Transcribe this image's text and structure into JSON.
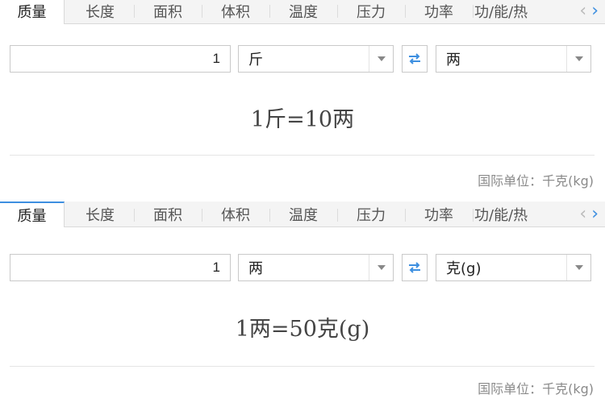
{
  "panels": [
    {
      "tabs": [
        "质量",
        "长度",
        "面积",
        "体积",
        "温度",
        "压力",
        "功率",
        "功/能/热"
      ],
      "active_tab": "质量",
      "input_value": "1",
      "from_unit": "斤",
      "to_unit": "两",
      "result": "1斤=10两",
      "footer": "国际单位：千克(kg)"
    },
    {
      "tabs": [
        "质量",
        "长度",
        "面积",
        "体积",
        "温度",
        "压力",
        "功率",
        "功/能/热"
      ],
      "active_tab": "质量",
      "input_value": "1",
      "from_unit": "两",
      "to_unit": "克(g)",
      "result": "1两=50克(g)",
      "footer": "国际单位：千克(kg)"
    }
  ],
  "icons": {
    "prev": "chevron-left-icon",
    "next": "chevron-right-icon",
    "swap": "swap-arrows-icon",
    "dropdown": "caret-down-icon"
  },
  "colors": {
    "accent": "#3d8fe0",
    "tab_bar": "#f4f4f4",
    "border": "#c9c9c9",
    "muted_text": "#8a8a8a"
  }
}
